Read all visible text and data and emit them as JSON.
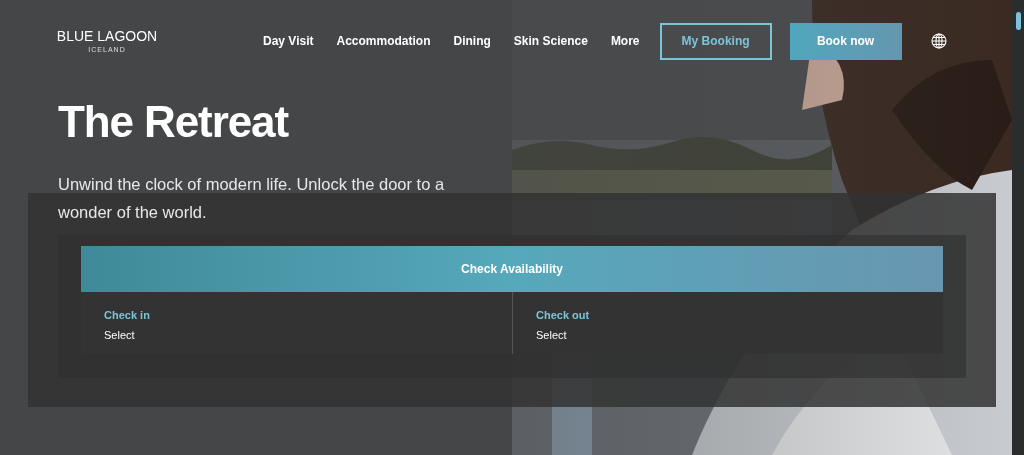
{
  "logo": {
    "name": "BLUE LAGOON",
    "sub": "ICELAND"
  },
  "nav": [
    {
      "label": "Day Visit"
    },
    {
      "label": "Accommodation"
    },
    {
      "label": "Dining"
    },
    {
      "label": "Skin Science"
    },
    {
      "label": "More"
    }
  ],
  "buttons": [
    {
      "label": "My Booking",
      "kind": "outline"
    },
    {
      "label": "Book now",
      "kind": "filled"
    }
  ],
  "hero": {
    "title": "The Retreat",
    "subtitle": "Unwind the clock of modern life. Unlock the door to a wonder of the world.",
    "kind": "picture"
  },
  "booking": {
    "header": "Check Availability",
    "fields": [
      {
        "label": "Check in",
        "value": "Select"
      },
      {
        "label": "Check out",
        "value": "Select"
      }
    ]
  }
}
